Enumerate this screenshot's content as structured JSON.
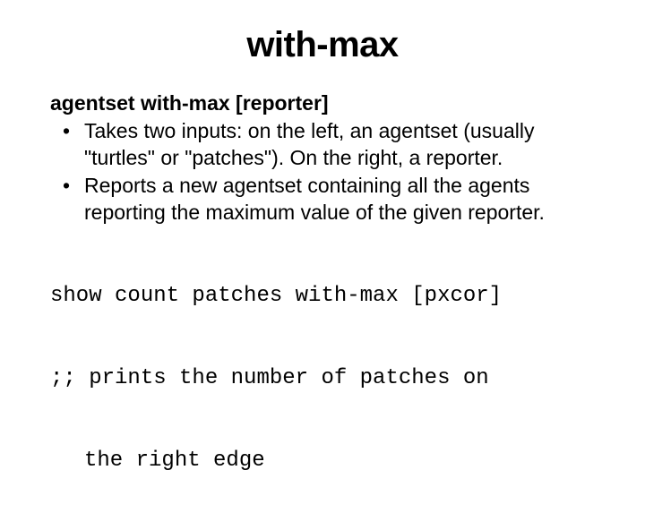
{
  "title": "with-max",
  "syntax": "agentset with-max [reporter]",
  "bullets": [
    "Takes two inputs: on the left, an agentset (usually \"turtles\" or \"patches\"). On the right, a reporter.",
    "Reports a new agentset containing all the agents reporting the maximum value of the given reporter."
  ],
  "code": {
    "line1": "show count patches with-max [pxcor]",
    "line2": ";; prints the number of patches on",
    "line3": "the right edge"
  }
}
